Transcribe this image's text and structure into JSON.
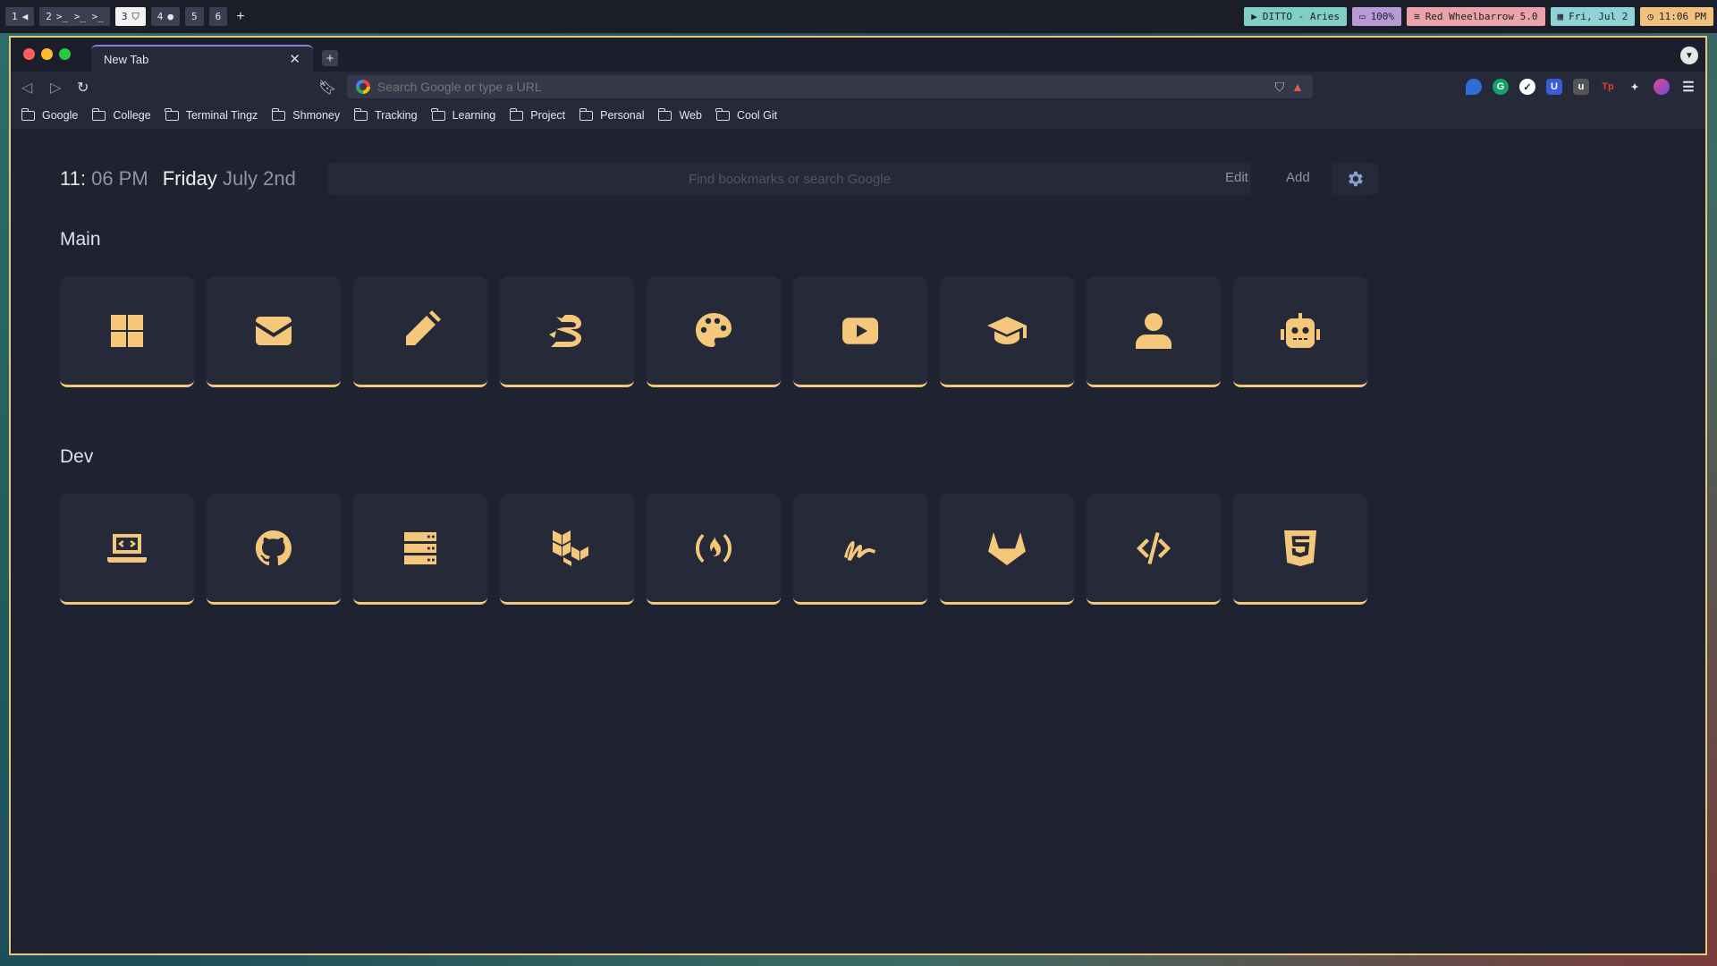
{
  "workspaces": [
    {
      "num": "1",
      "icon": "◀",
      "active": false
    },
    {
      "num": "2",
      "icon": ">_ >_ >_",
      "active": false
    },
    {
      "num": "3",
      "icon": "⛉",
      "active": true
    },
    {
      "num": "4",
      "icon": "●",
      "active": false
    },
    {
      "num": "5",
      "icon": "",
      "active": false
    },
    {
      "num": "6",
      "icon": "",
      "active": false
    }
  ],
  "status": {
    "media": "DITTO - Aries",
    "battery": "100%",
    "wifi": "Red Wheelbarrow 5.0",
    "date": "Fri, Jul 2",
    "time": "11:06 PM",
    "colors": {
      "media": "#7fcfc4",
      "battery": "#b79ad6",
      "wifi": "#e9a3a9",
      "date": "#8fd3d6",
      "time": "#f1c27d"
    }
  },
  "browser": {
    "tab_title": "New Tab",
    "omnibox_placeholder": "Search Google or type a URL",
    "bookmarks": [
      "Google",
      "College",
      "Terminal Tingz",
      "Shmoney",
      "Tracking",
      "Learning",
      "Project",
      "Personal",
      "Web",
      "Cool Git"
    ]
  },
  "page": {
    "clock_hour": "11",
    "clock_sep": ":",
    "clock_min": "06 PM",
    "date_day": "Friday",
    "date_md": "July 2nd",
    "search_placeholder": "Find bookmarks or search Google",
    "edit_label": "Edit",
    "add_label": "Add",
    "accent": "#f4c77b",
    "sections": [
      {
        "title": "Main",
        "tiles": [
          "windows-icon",
          "mail-icon",
          "pencil-icon",
          "dragon-icon",
          "palette-icon",
          "youtube-icon",
          "graduation-cap-icon",
          "user-icon",
          "robot-icon"
        ]
      },
      {
        "title": "Dev",
        "tiles": [
          "laptop-code-icon",
          "github-icon",
          "server-icon",
          "boxes-icon",
          "freecodecamp-icon",
          "signature-icon",
          "gitlab-icon",
          "code-icon",
          "html5-icon"
        ]
      }
    ]
  }
}
